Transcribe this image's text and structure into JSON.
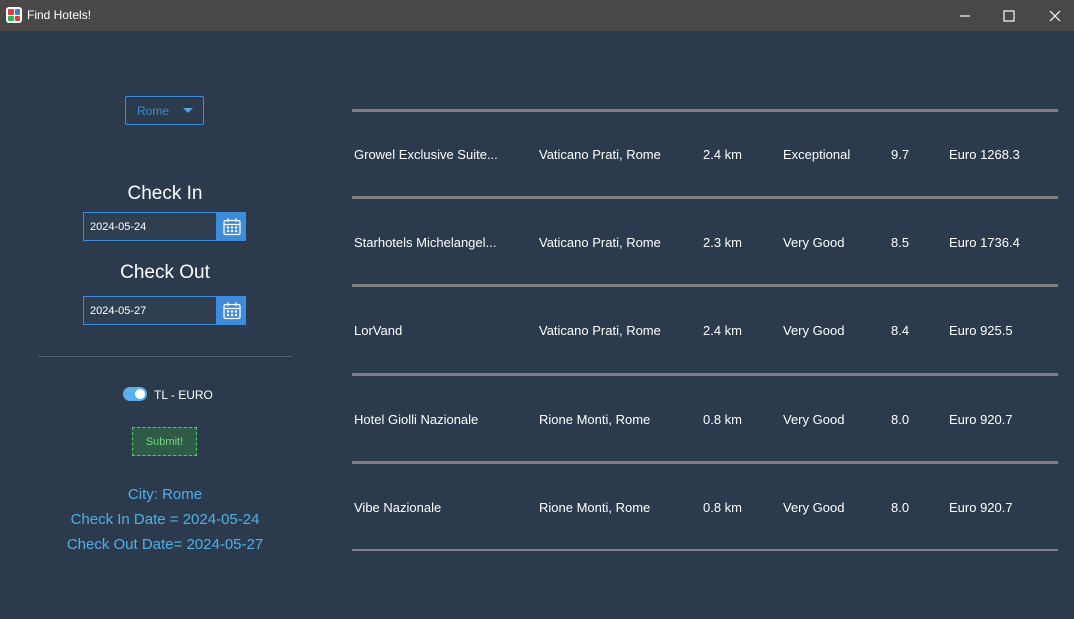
{
  "window": {
    "title": "Find Hotels!",
    "controls": [
      "minimize-icon",
      "maximize-icon",
      "close-icon"
    ]
  },
  "filters": {
    "city": "Rome",
    "check_in_label": "Check In",
    "check_in_value": "2024-05-24",
    "check_out_label": "Check Out",
    "check_out_value": "2024-05-27",
    "currency_toggle_label": "TL - EURO",
    "currency_toggle_on": true,
    "submit_label": "Submit!"
  },
  "summary": {
    "city_line": "City: Rome",
    "check_in_line": "Check In Date = 2024-05-24",
    "check_out_line": "Check Out Date= 2024-05-27"
  },
  "hotels": [
    {
      "name": "Growel Exclusive Suite...",
      "location": "Vaticano Prati, Rome",
      "distance": "2.4 km",
      "rating": "Exceptional",
      "score": "9.7",
      "price": "Euro 1268.3"
    },
    {
      "name": "Starhotels Michelangel...",
      "location": "Vaticano Prati, Rome",
      "distance": "2.3 km",
      "rating": "Very Good",
      "score": "8.5",
      "price": "Euro 1736.4"
    },
    {
      "name": "LorVand",
      "location": "Vaticano Prati, Rome",
      "distance": "2.4 km",
      "rating": "Very Good",
      "score": "8.4",
      "price": "Euro 925.5"
    },
    {
      "name": "Hotel Giolli Nazionale",
      "location": "Rione Monti, Rome",
      "distance": "0.8 km",
      "rating": "Very Good",
      "score": "8.0",
      "price": "Euro 920.7"
    },
    {
      "name": "Vibe Nazionale",
      "location": "Rione Monti, Rome",
      "distance": "0.8 km",
      "rating": "Very Good",
      "score": "8.0",
      "price": "Euro 920.7"
    }
  ],
  "colors": {
    "background": "#2b3a4c",
    "accent_blue": "#3d8bd9",
    "info_text": "#4fb0e8",
    "submit_green": "#4fcf6a"
  }
}
